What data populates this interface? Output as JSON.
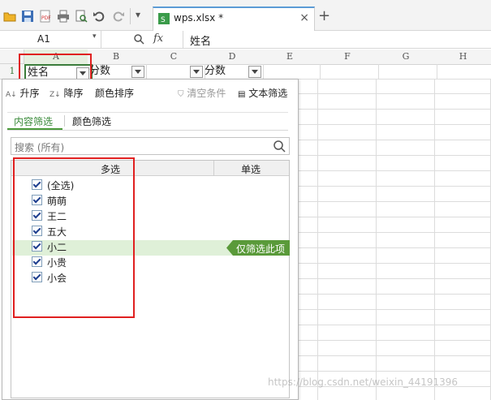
{
  "toolbar": {
    "tab_title": "wps.xlsx *",
    "tab_close": "×",
    "new_tab": "+",
    "dropdown": "▾"
  },
  "formula_bar": {
    "cell_ref": "A1",
    "fx": "fx",
    "content": "姓名"
  },
  "columns": [
    "A",
    "B",
    "C",
    "D",
    "E",
    "F",
    "G",
    "H"
  ],
  "row1": {
    "num": "1",
    "a": "姓名",
    "b": "分数",
    "c": "",
    "d": "分数"
  },
  "filter_panel": {
    "sort_asc": "升序",
    "sort_desc": "降序",
    "color_sort": "颜色排序",
    "clear_cond": "清空条件",
    "text_filter": "文本筛选",
    "tab_content": "内容筛选",
    "tab_color": "颜色筛选",
    "search_placeholder": "搜索 (所有)",
    "col_multi": "多选",
    "col_single": "单选",
    "items": [
      "(全选)",
      "萌萌",
      "王二",
      "五大",
      "小二",
      "小贵",
      "小会"
    ],
    "only_filter_this": "仅筛选此项"
  },
  "watermark": "https://blog.csdn.net/weixin_44191396",
  "colors": {
    "accent_green": "#5a9a3a",
    "highlight": "#dff0d8",
    "red_box": "#e02020",
    "tab_underline": "#5b9bd5"
  }
}
